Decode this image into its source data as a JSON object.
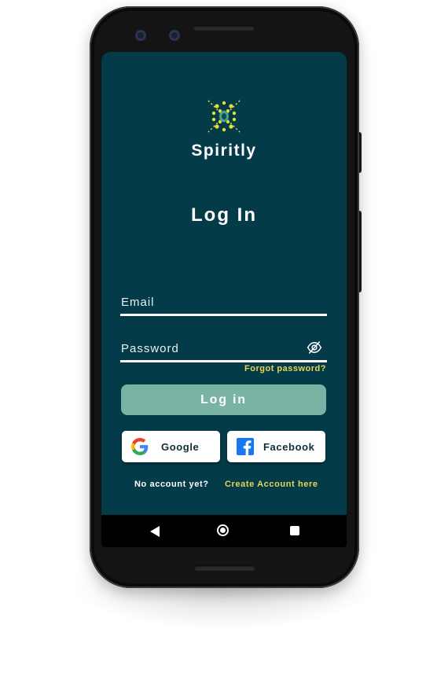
{
  "app": {
    "name": "Spiritly"
  },
  "login": {
    "title": "Log In",
    "email_label": "Email",
    "password_label": "Password",
    "forgot_password": "Forgot password?",
    "submit_label": "Log in",
    "google_label": "Google",
    "facebook_label": "Facebook",
    "no_account": "No account yet?",
    "create_account": "Create Account here"
  },
  "icons": {
    "logo": "spiritly-logo-icon",
    "password_toggle": "eye-slash-icon",
    "google": "google-icon",
    "facebook": "facebook-icon",
    "nav_back": "back-triangle-icon",
    "nav_home": "home-circle-icon",
    "nav_recents": "recents-square-icon"
  },
  "colors": {
    "background": "#043b48",
    "accent_yellow": "#e6d65a",
    "login_button": "#7ab3a3",
    "facebook_blue": "#1877f2"
  }
}
